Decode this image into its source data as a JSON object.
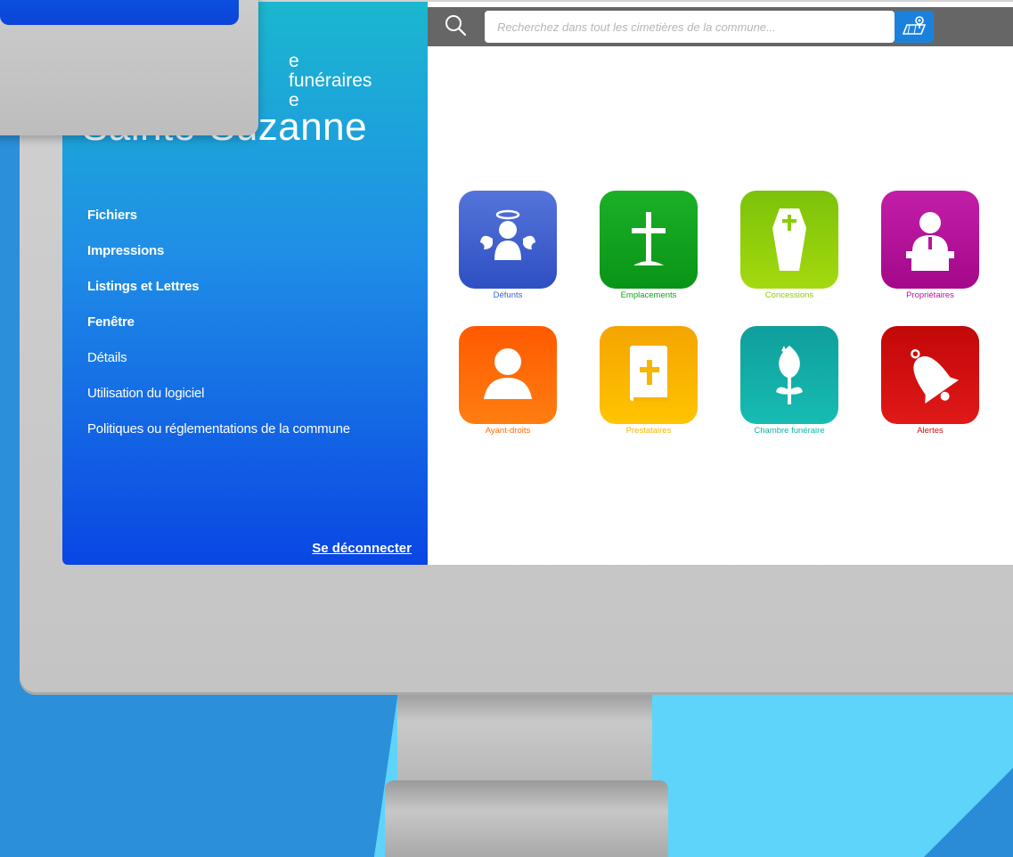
{
  "sidebar": {
    "subtitle_line1": "e funéraires",
    "subtitle_line2": "e",
    "city": "Sainte-Suzanne",
    "menu": [
      {
        "label": "Fichiers",
        "bold": true
      },
      {
        "label": "Impressions",
        "bold": true
      },
      {
        "label": "Listings et Lettres",
        "bold": true
      },
      {
        "label": "Fenêtre",
        "bold": true
      },
      {
        "label": "Détails",
        "bold": false
      },
      {
        "label": "Utilisation du logiciel",
        "bold": false
      },
      {
        "label": "Politiques ou réglementations de la commune",
        "bold": false
      }
    ],
    "logout_label": "Se déconnecter"
  },
  "search": {
    "placeholder": "Recherchez dans tout les cimetières de la commune...",
    "icon": "search-icon",
    "map_icon": "map-pin-icon"
  },
  "tiles": [
    {
      "label": "Défunts",
      "icon": "angel-icon",
      "color": "#3a62d2",
      "label_color": "#3a62d2"
    },
    {
      "label": "Emplacements",
      "icon": "cross-icon",
      "color": "#12a21a",
      "label_color": "#12a21a"
    },
    {
      "label": "Concessions",
      "icon": "coffin-icon",
      "color": "#8ccc0a",
      "label_color": "#8ccc0a"
    },
    {
      "label": "Propriétaires",
      "icon": "speaker-icon",
      "color": "#b8159a",
      "label_color": "#b8159a"
    },
    {
      "label": "Ayant-droits",
      "icon": "person-icon",
      "color": "#ff6a00",
      "label_color": "#ff6a00"
    },
    {
      "label": "Prestataires",
      "icon": "bible-icon",
      "color": "#f7b500",
      "label_color": "#f7b500"
    },
    {
      "label": "Chambre funéraire",
      "icon": "flower-icon",
      "color": "#11b1a8",
      "label_color": "#11b1a8"
    },
    {
      "label": "Alertes",
      "icon": "bell-icon",
      "color": "#d20f0f",
      "label_color": "#d20f0f"
    }
  ]
}
